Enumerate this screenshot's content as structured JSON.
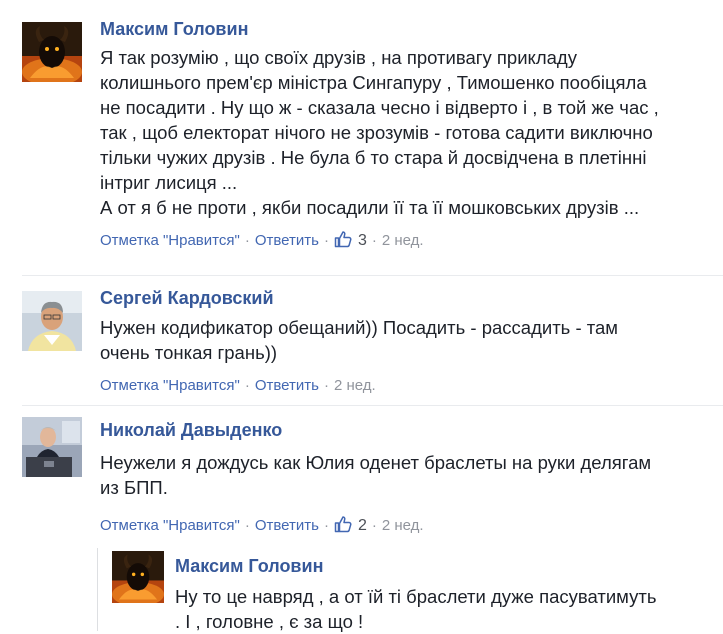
{
  "colors": {
    "author": "#365899",
    "link": "#4267b2",
    "meta": "#90949c",
    "text": "#1d2129"
  },
  "comments": [
    {
      "author": "Максим Головин",
      "avatar_icon": "demon-avatar-icon",
      "text": "Я так розумію , що своїх друзів , на противагу прикладу\nколишнього прем'єр міністра Сингапуру , Тимошенко пообіцяла\nне посадити . Ну що ж - сказала чесно і відверто і , в той же час ,\nтак , щоб електорат нічого не зрозумів - готова садити виключно\nтільки чужих друзів . Не була б то стара й досвідчена в плетінні\nінтриг лисиця ...\nА от я б не проти , якби посадили її та її мошковських друзів ...",
      "like_label": "Отметка \"Нравится\"",
      "reply_label": "Ответить",
      "likes": "3",
      "time": "2 нед."
    },
    {
      "author": "Сергей Кардовский",
      "avatar_icon": "man-portrait-avatar-icon",
      "text": "Нужен кодификатор обещаний)) Посадить - рассадить - там\nочень тонкая грань))",
      "like_label": "Отметка \"Нравится\"",
      "reply_label": "Ответить",
      "time": "2 нед."
    },
    {
      "author": "Николай Давыденко",
      "avatar_icon": "speaker-podium-avatar-icon",
      "text": "Неужели я дождусь как Юлия оденет браслеты на руки делягам\nиз БПП.",
      "like_label": "Отметка \"Нравится\"",
      "reply_label": "Ответить",
      "likes": "2",
      "time": "2 нед."
    }
  ],
  "reply": {
    "author": "Максим Головин",
    "avatar_icon": "demon-avatar-icon",
    "text": "Ну то це навряд , а от їй ті браслети дуже пасуватимуть\n. І , головне , є за що !"
  }
}
